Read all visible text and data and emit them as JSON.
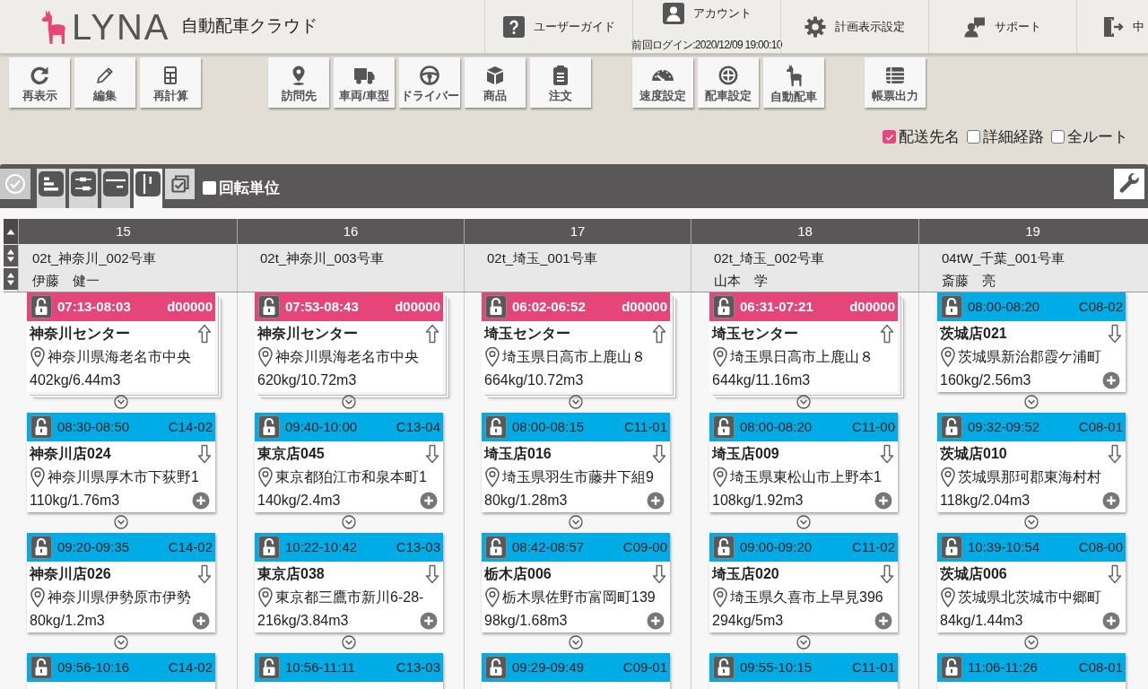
{
  "header": {
    "logo": "LYNA",
    "app_title": "自動配車クラウド",
    "nav": [
      {
        "label": "ユーザーガイド"
      },
      {
        "label": "アカウント",
        "sub": "前回ログイン:2020/12/09 19:00:10"
      },
      {
        "label": "計画表示設定"
      },
      {
        "label": "サポート"
      },
      {
        "label": "中"
      }
    ]
  },
  "toolbar": [
    {
      "buttons": [
        "再表示",
        "編集",
        "再計算"
      ]
    },
    {
      "buttons": [
        "訪問先",
        "車両/車型",
        "ドライバー",
        "商品",
        "注文"
      ]
    },
    {
      "buttons": [
        "速度設定",
        "配車設定",
        "自動配車"
      ]
    },
    {
      "buttons": [
        "帳票出力"
      ]
    }
  ],
  "display_options": [
    {
      "label": "配送先名",
      "checked": true
    },
    {
      "label": "詳細経路",
      "checked": false
    },
    {
      "label": "全ルート",
      "checked": false
    }
  ],
  "view_bar": {
    "view_tabs": [
      {
        "selected": false
      },
      {
        "selected": false
      },
      {
        "selected": false
      },
      {
        "selected": true
      }
    ],
    "rotation_unit": {
      "label": "回転単位",
      "checked": false
    }
  },
  "routes": [
    {
      "column": "15",
      "vehicle": "02t_神奈川_002号車",
      "driver": "伊藤　健一",
      "stops": [
        {
          "kind": "depot",
          "locked": false,
          "time": "07:13-08:03",
          "code": "d00000",
          "name": "神奈川センター",
          "address": "神奈川県海老名市中央",
          "load": "402kg/6.44m3"
        },
        {
          "kind": "stop",
          "locked": false,
          "time": "08:30-08:50",
          "code": "C14-02",
          "name": "神奈川店024",
          "address": "神奈川県厚木市下荻野1",
          "load": "110kg/1.76m3"
        },
        {
          "kind": "stop",
          "locked": false,
          "time": "09:20-09:35",
          "code": "C14-02",
          "name": "神奈川店026",
          "address": "神奈川県伊勢原市伊勢",
          "load": "80kg/1.2m3"
        },
        {
          "kind": "stop",
          "locked": false,
          "time": "09:56-10:16",
          "code": "C14-02"
        }
      ]
    },
    {
      "column": "16",
      "vehicle": "02t_神奈川_003号車",
      "stops": [
        {
          "kind": "depot",
          "locked": false,
          "time": "07:53-08:43",
          "code": "d00000",
          "name": "神奈川センター",
          "address": "神奈川県海老名市中央",
          "load": "620kg/10.72m3"
        },
        {
          "kind": "stop",
          "locked": false,
          "time": "09:40-10:00",
          "code": "C13-04",
          "name": "東京店045",
          "address": "東京都狛江市和泉本町1",
          "load": "140kg/2.4m3"
        },
        {
          "kind": "stop",
          "locked": false,
          "time": "10:22-10:42",
          "code": "C13-03",
          "name": "東京店038",
          "address": "東京都三鷹市新川6-28-",
          "load": "216kg/3.84m3"
        },
        {
          "kind": "stop",
          "locked": false,
          "time": "10:56-11:11",
          "code": "C13-03"
        }
      ]
    },
    {
      "column": "17",
      "vehicle": "02t_埼玉_001号車",
      "stops": [
        {
          "kind": "depot",
          "locked": false,
          "time": "06:02-06:52",
          "code": "d00000",
          "name": "埼玉センター",
          "address": "埼玉県日高市上鹿山８",
          "load": "664kg/10.72m3"
        },
        {
          "kind": "stop",
          "locked": false,
          "time": "08:00-08:15",
          "code": "C11-01",
          "name": "埼玉店016",
          "address": "埼玉県羽生市藤井下組9",
          "load": "80kg/1.28m3"
        },
        {
          "kind": "stop",
          "locked": false,
          "time": "08:42-08:57",
          "code": "C09-00",
          "name": "栃木店006",
          "address": "栃木県佐野市富岡町139",
          "load": "98kg/1.68m3"
        },
        {
          "kind": "stop",
          "locked": false,
          "time": "09:29-09:49",
          "code": "C09-01"
        }
      ]
    },
    {
      "column": "18",
      "vehicle": "02t_埼玉_002号車",
      "driver": "山本　学",
      "stops": [
        {
          "kind": "depot",
          "locked": false,
          "time": "06:31-07:21",
          "code": "d00000",
          "name": "埼玉センター",
          "address": "埼玉県日高市上鹿山８",
          "load": "644kg/11.16m3"
        },
        {
          "kind": "stop",
          "locked": false,
          "time": "08:00-08:20",
          "code": "C11-00",
          "name": "埼玉店009",
          "address": "埼玉県東松山市上野本1",
          "load": "108kg/1.92m3"
        },
        {
          "kind": "stop",
          "locked": false,
          "time": "09:00-09:20",
          "code": "C11-02",
          "name": "埼玉店020",
          "address": "埼玉県久喜市上早見396",
          "load": "294kg/5m3"
        },
        {
          "kind": "stop",
          "locked": false,
          "time": "09:55-10:15",
          "code": "C11-01"
        }
      ]
    },
    {
      "column": "19",
      "vehicle": "04tW_千葉_001号車",
      "driver": "斎藤　亮",
      "stops": [
        {
          "kind": "stop",
          "locked": false,
          "time": "08:00-08:20",
          "code": "C08-02",
          "name": "茨城店021",
          "address": "茨城県新治郡霞ケ浦町",
          "load": "160kg/2.56m3"
        },
        {
          "kind": "stop",
          "locked": false,
          "time": "09:32-09:52",
          "code": "C08-01",
          "name": "茨城店010",
          "address": "茨城県那珂郡東海村村",
          "load": "118kg/2.04m3"
        },
        {
          "kind": "stop",
          "locked": false,
          "time": "10:39-10:54",
          "code": "C08-00",
          "name": "茨城店006",
          "address": "茨城県北茨城市中郷町",
          "load": "84kg/1.44m3"
        },
        {
          "kind": "stop",
          "locked": false,
          "time": "11:06-11:26",
          "code": "C08-01"
        }
      ]
    }
  ]
}
